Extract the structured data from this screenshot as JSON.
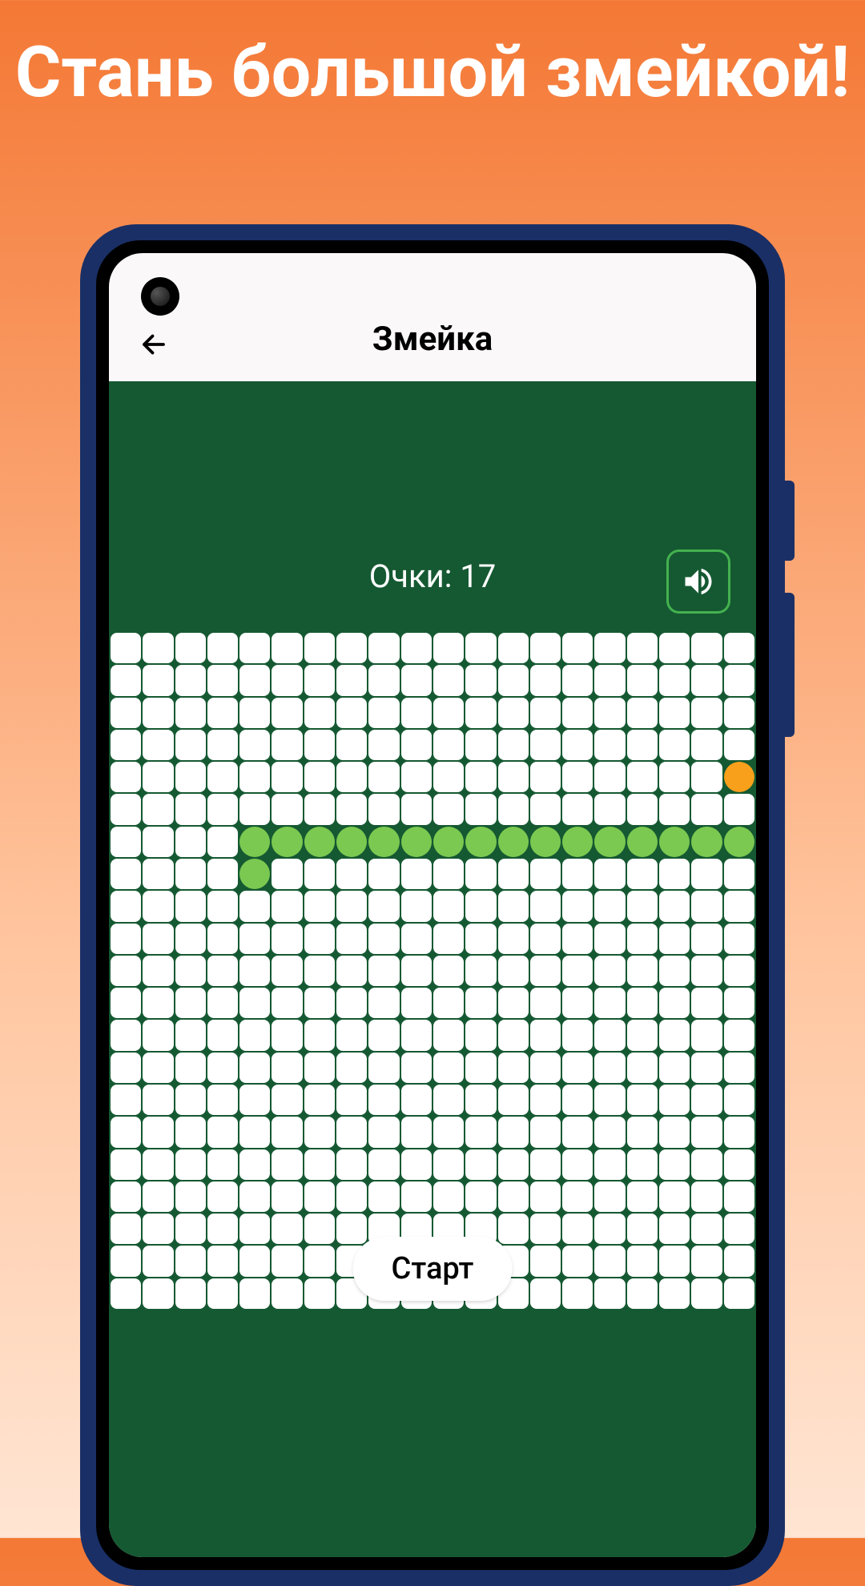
{
  "promo": {
    "headline": "Стань большой змейкой!"
  },
  "app": {
    "title": "Змейка"
  },
  "game": {
    "score_label": "Очки: ",
    "score_value": 17,
    "start_label": "Старт",
    "grid": {
      "cols": 20,
      "rows": 21
    },
    "snake_cells": [
      {
        "r": 6,
        "c": 4
      },
      {
        "r": 6,
        "c": 5
      },
      {
        "r": 6,
        "c": 6
      },
      {
        "r": 6,
        "c": 7
      },
      {
        "r": 6,
        "c": 8
      },
      {
        "r": 6,
        "c": 9
      },
      {
        "r": 6,
        "c": 10
      },
      {
        "r": 6,
        "c": 11
      },
      {
        "r": 6,
        "c": 12
      },
      {
        "r": 6,
        "c": 13
      },
      {
        "r": 6,
        "c": 14
      },
      {
        "r": 6,
        "c": 15
      },
      {
        "r": 6,
        "c": 16
      },
      {
        "r": 6,
        "c": 17
      },
      {
        "r": 6,
        "c": 18
      },
      {
        "r": 6,
        "c": 19
      },
      {
        "r": 7,
        "c": 4
      }
    ],
    "food_cell": {
      "r": 4,
      "c": 19
    }
  },
  "icons": {
    "back": "back-arrow",
    "sound": "speaker-on"
  },
  "colors": {
    "snake": "#7bc950",
    "food": "#f89f1b",
    "board": "#155932",
    "accent": "#44b24f"
  }
}
